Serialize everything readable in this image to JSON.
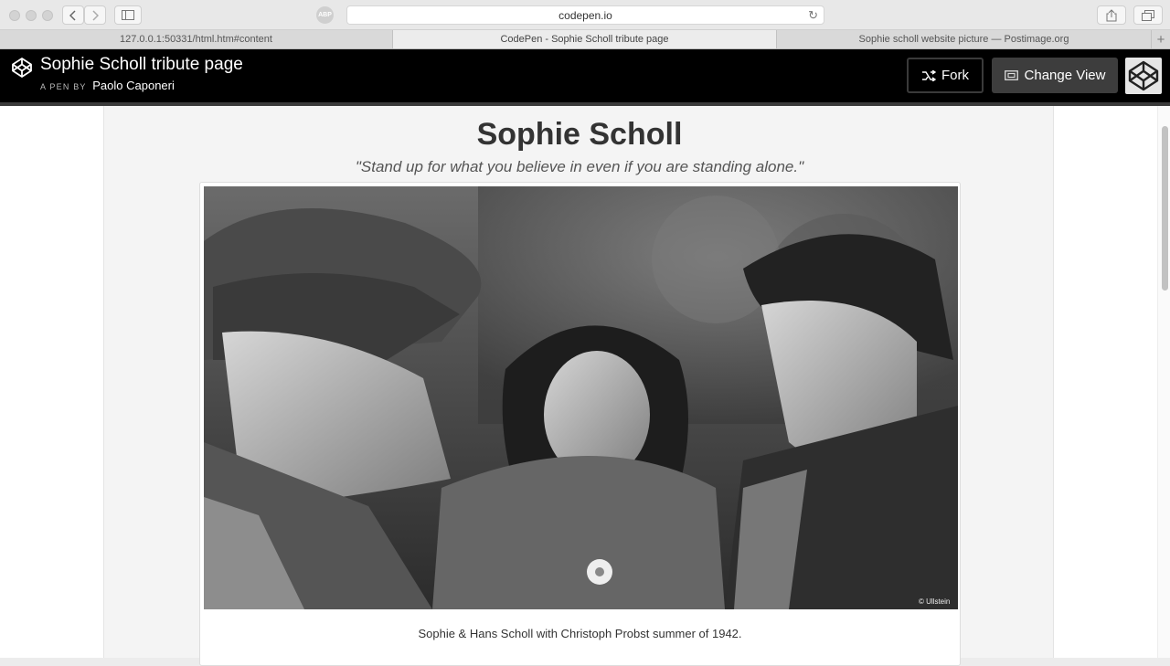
{
  "browser": {
    "address": "codepen.io",
    "abp_label": "ABP",
    "tabs": [
      {
        "label": "127.0.0.1:50331/html.htm#content",
        "active": false
      },
      {
        "label": "CodePen - Sophie Scholl tribute page",
        "active": true
      },
      {
        "label": "Sophie scholl website picture — Postimage.org",
        "active": false
      }
    ]
  },
  "codepen": {
    "pen_title": "Sophie Scholl tribute page",
    "by_prefix": "A PEN BY",
    "author": "Paolo Caponeri",
    "fork_label": "Fork",
    "change_view_label": "Change View"
  },
  "page": {
    "title": "Sophie Scholl",
    "quote": "\"Stand up for what you believe in even if you are standing alone.\"",
    "image_credit": "© Ullstein",
    "caption": "Sophie & Hans Scholl with Christoph Probst summer of 1942."
  },
  "colors": {
    "header_bg": "#000000",
    "card_bg": "#f4f4f4",
    "change_view_bg": "#3d3d3d"
  }
}
